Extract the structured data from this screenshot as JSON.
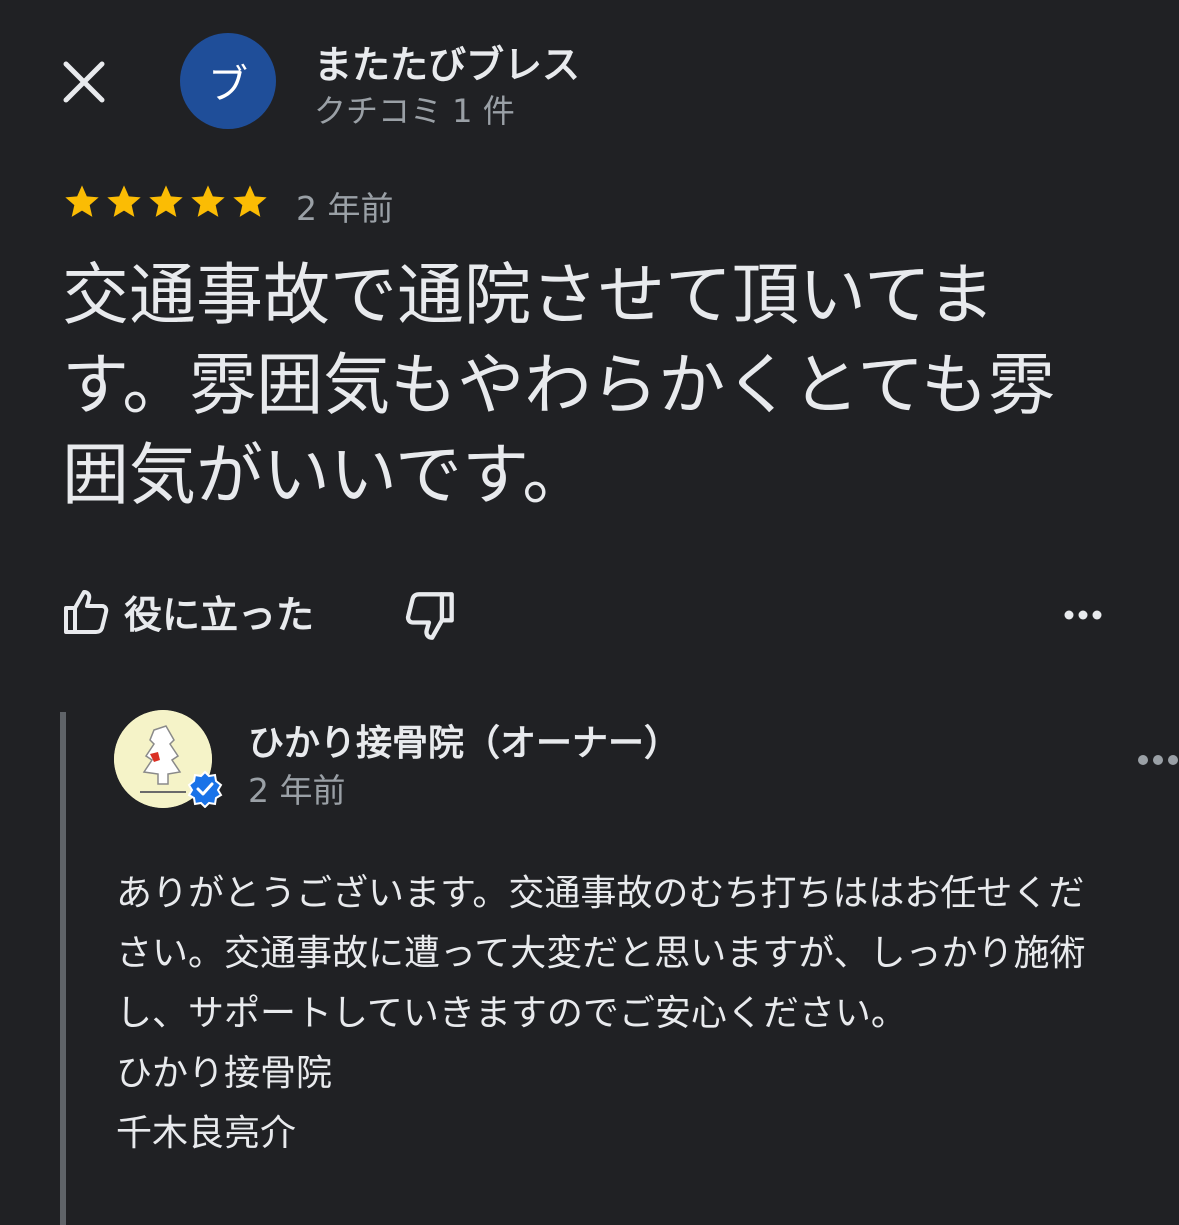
{
  "header": {
    "avatar_letter": "ブ",
    "reviewer_name": "またたびブレス",
    "review_count": "クチコミ 1 件",
    "avatar_color": "#1f4e99"
  },
  "review": {
    "rating": 5,
    "rating_max": 5,
    "time": "2 年前",
    "text": "交通事故で通院させて頂いてます。雰囲気もやわらかくとても雰囲気がいいです。",
    "star_color": "#fbbc04"
  },
  "actions": {
    "helpful_label": "役に立った"
  },
  "owner_reply": {
    "name": "ひかり接骨院（オーナー）",
    "time": "2 年前",
    "paragraph": "ありがとうございます。交通事故のむち打ちははお任せください。交通事故に遭って大変だと思いますが、しっかり施術し、サポートしていきますのでご安心ください。",
    "clinic_name": "ひかり接骨院",
    "signature": "千木良亮介",
    "verified_color": "#1a73e8"
  }
}
